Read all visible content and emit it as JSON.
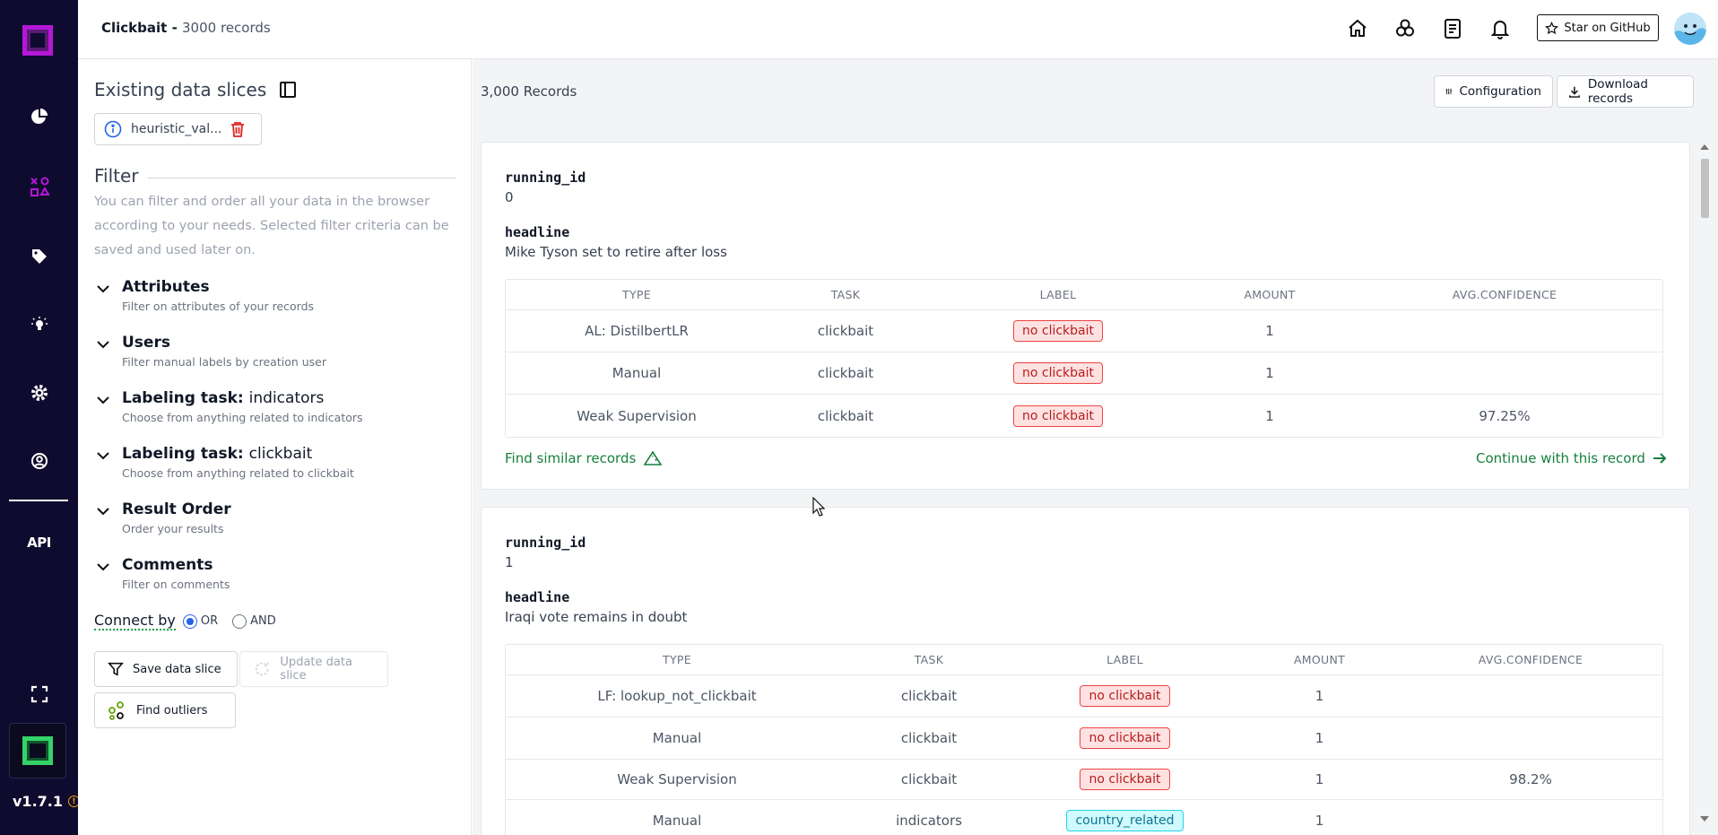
{
  "header": {
    "project": "Clickbait",
    "separator": " - ",
    "count": "3000 records",
    "star_label": "Star on GitHub"
  },
  "rail": {
    "api_label": "API",
    "version": "v1.7.1",
    "info_glyph": "!"
  },
  "sidebar": {
    "slices_title": "Existing data slices",
    "slice_chip": "heuristic_val...",
    "filter_title": "Filter",
    "filter_desc": "You can filter and order all your data in the browser according to your needs. Selected filter criteria can be saved and used later on.",
    "sections": [
      {
        "title": "Attributes",
        "sub": "",
        "desc": "Filter on attributes of your records"
      },
      {
        "title": "Users",
        "sub": "",
        "desc": "Filter manual labels by creation user"
      },
      {
        "title": "Labeling task:",
        "sub": "indicators",
        "desc": "Choose from anything related to indicators"
      },
      {
        "title": "Labeling task:",
        "sub": "clickbait",
        "desc": "Choose from anything related to clickbait"
      },
      {
        "title": "Result Order",
        "sub": "",
        "desc": "Order your results"
      },
      {
        "title": "Comments",
        "sub": "",
        "desc": "Filter on comments"
      }
    ],
    "connect_label": "Connect by",
    "or_label": "OR",
    "and_label": "AND",
    "save_slice": "Save data slice",
    "update_slice": "Update data slice",
    "find_outliers": "Find outliers"
  },
  "main": {
    "record_count": "3,000 Records",
    "configuration": "Configuration",
    "download": "Download records",
    "columns": [
      "TYPE",
      "TASK",
      "LABEL",
      "AMOUNT",
      "AVG.CONFIDENCE"
    ],
    "find_similar": "Find similar records",
    "continue": "Continue with this record",
    "records": [
      {
        "id_label": "running_id",
        "id_value": "0",
        "headline_label": "headline",
        "headline_value": "Mike Tyson set to retire after loss",
        "rows": [
          {
            "type": "AL: DistilbertLR",
            "task": "clickbait",
            "label": "no clickbait",
            "amount": "1",
            "conf": ""
          },
          {
            "type": "Manual",
            "task": "clickbait",
            "label": "no clickbait",
            "amount": "1",
            "conf": ""
          },
          {
            "type": "Weak Supervision",
            "task": "clickbait",
            "label": "no clickbait",
            "amount": "1",
            "conf": "97.25%"
          }
        ]
      },
      {
        "id_label": "running_id",
        "id_value": "1",
        "headline_label": "headline",
        "headline_value": "Iraqi vote remains in doubt",
        "rows": [
          {
            "type": "LF: lookup_not_clickbait",
            "task": "clickbait",
            "label": "no clickbait",
            "amount": "1",
            "conf": ""
          },
          {
            "type": "Manual",
            "task": "clickbait",
            "label": "no clickbait",
            "amount": "1",
            "conf": ""
          },
          {
            "type": "Weak Supervision",
            "task": "clickbait",
            "label": "no clickbait",
            "amount": "1",
            "conf": "98.2%"
          },
          {
            "type": "Manual",
            "task": "indicators",
            "label": "country_related",
            "amount": "1",
            "conf": ""
          }
        ]
      }
    ]
  },
  "colors": {
    "rail_bg": "#0f0b2e",
    "accent_link": "#15803d",
    "badge_red": "#ef4444",
    "badge_cyan": "#22d3ee"
  }
}
